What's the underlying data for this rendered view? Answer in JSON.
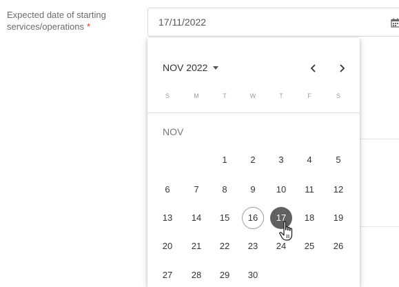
{
  "field": {
    "label": "Expected date of starting services/operations",
    "required_marker": "*",
    "value": "17/11/2022",
    "icon": "calendar-icon"
  },
  "picker": {
    "month_year": "NOV 2022",
    "prev_label": "‹",
    "next_label": "›",
    "weekdays": [
      "S",
      "M",
      "T",
      "W",
      "T",
      "F",
      "S"
    ],
    "month_label": "NOV",
    "weeks": [
      [
        "",
        "",
        "1",
        "2",
        "3",
        "4",
        "5"
      ],
      [
        "6",
        "7",
        "8",
        "9",
        "10",
        "11",
        "12"
      ],
      [
        "13",
        "14",
        "15",
        "16",
        "17",
        "18",
        "19"
      ],
      [
        "20",
        "21",
        "22",
        "23",
        "24",
        "25",
        "26"
      ],
      [
        "27",
        "28",
        "29",
        "30",
        "",
        "",
        ""
      ]
    ],
    "today": "16",
    "selected": "17"
  }
}
